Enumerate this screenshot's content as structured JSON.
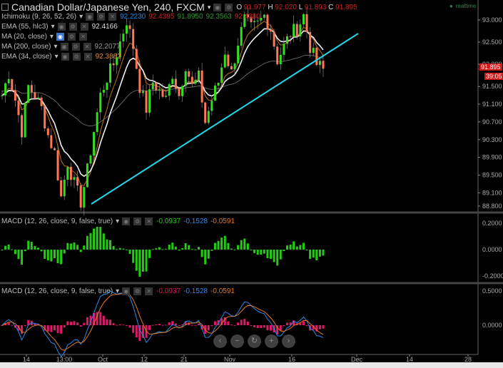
{
  "header": {
    "title": "Canadian Dollar/Japanese Yen, 240, FXCM",
    "ohlc": {
      "o_label": "O",
      "o": "91.977",
      "h_label": "H",
      "h": "92.020",
      "l_label": "L",
      "l": "91.893",
      "c_label": "C",
      "c": "91.895"
    },
    "realtime": "realtime"
  },
  "indicators": [
    {
      "name": "Ichimoku (9, 26, 52, 26)",
      "values": [
        "92.2230",
        "92.4395",
        "91.8950",
        "92.3563",
        "92.4380"
      ]
    },
    {
      "name": "EMA (55, hlc3)",
      "values": [
        "92.4166"
      ]
    },
    {
      "name": "MA (20, close)",
      "values": []
    },
    {
      "name": "MA (200, close)",
      "values": [
        "92.2077"
      ]
    },
    {
      "name": "EMA (34, close)",
      "values": [
        "92.3882"
      ]
    }
  ],
  "macd1": {
    "name": "MACD (12, 26, close, 9, false, true)",
    "values": [
      "-0.0937",
      "-0.1528",
      "-0.0591"
    ],
    "ticks": [
      "0.2000",
      "0.0000",
      "-0.2000"
    ]
  },
  "macd2": {
    "name": "MACD (12, 26, close, 9, false, true)",
    "values": [
      "-0.0937",
      "-0.1528",
      "-0.0591"
    ],
    "ticks": [
      "0.5000",
      "0.0000"
    ]
  },
  "price_label": "91.895",
  "countdown": "39:05",
  "nav": [
    "‹",
    "−",
    "↻",
    "+",
    "›"
  ],
  "colors": {
    "up": "#33dd22",
    "down": "#ff7755",
    "trend": "#22d8e8",
    "macd": "#2a8ae8",
    "signal": "#e07820",
    "hist1": "#22cc11",
    "hist2": "#e0186a"
  },
  "chart_data": {
    "type": "candlestick",
    "title": "Canadian Dollar/Japanese Yen, 240, FXCM",
    "y_ticks": [
      "93.000",
      "92.500",
      "92.000",
      "91.500",
      "91.100",
      "90.700",
      "90.300",
      "89.900",
      "89.500",
      "89.100",
      "88.800"
    ],
    "ylim": [
      88.7,
      93.4
    ],
    "x_ticks": [
      "14",
      "13:00",
      "Oct",
      "12",
      "21",
      "Nov",
      "16",
      "Dec",
      "14",
      "28"
    ],
    "closes": [
      91.3,
      91.8,
      91.2,
      90.5,
      91.5,
      91.3,
      91.0,
      90.4,
      90.0,
      89.0,
      89.8,
      89.3,
      88.9,
      89.6,
      90.5,
      91.3,
      91.7,
      92.0,
      92.5,
      93.0,
      92.4,
      91.5,
      91.0,
      91.6,
      91.4,
      91.2,
      91.8,
      91.3,
      92.0,
      91.5,
      91.7,
      90.7,
      91.2,
      91.6,
      92.3,
      91.8,
      92.5,
      93.0,
      92.8,
      92.9,
      93.1,
      92.8,
      92.1,
      92.4,
      92.7,
      92.8,
      93.1,
      92.4,
      92.0,
      91.9
    ],
    "trendline": {
      "from": [
        88.85,
        "late Sep"
      ],
      "to": [
        92.7,
        "Dec"
      ]
    }
  }
}
